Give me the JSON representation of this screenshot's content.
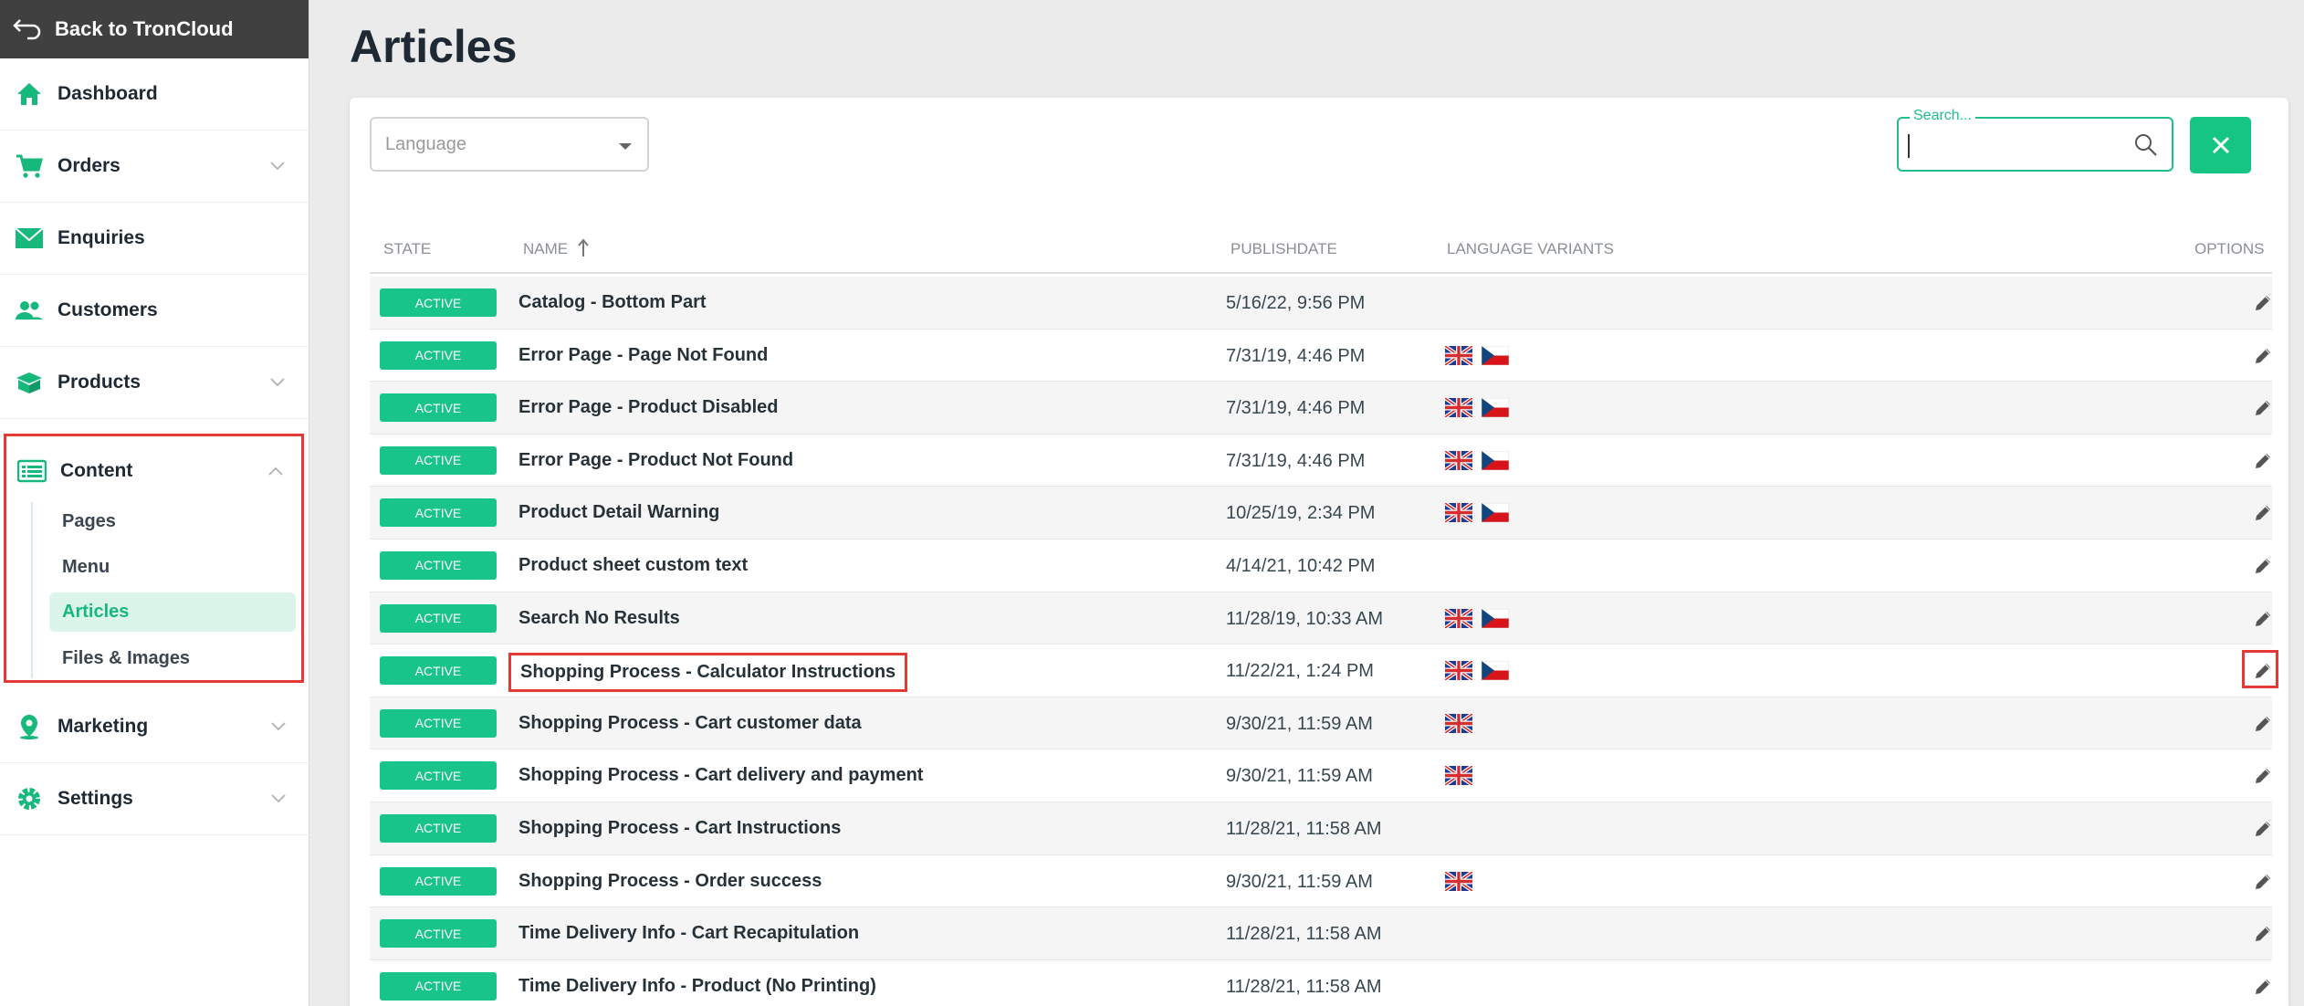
{
  "sidebar": {
    "back_label": "Back to TronCloud",
    "items": [
      {
        "label": "Dashboard",
        "icon": "home-icon"
      },
      {
        "label": "Orders",
        "icon": "cart-icon"
      },
      {
        "label": "Enquiries",
        "icon": "mail-icon"
      },
      {
        "label": "Customers",
        "icon": "people-icon"
      },
      {
        "label": "Products",
        "icon": "box-icon"
      },
      {
        "label": "Content",
        "icon": "list-icon"
      },
      {
        "label": "Marketing",
        "icon": "location-pin-icon"
      },
      {
        "label": "Settings",
        "icon": "gear-icon"
      }
    ],
    "content_sub": [
      "Pages",
      "Menu",
      "Articles",
      "Files & Images"
    ]
  },
  "page": {
    "title": "Articles",
    "language_placeholder": "Language",
    "search_label": "Search..."
  },
  "table": {
    "headers": {
      "state": "STATE",
      "name": "NAME",
      "publishdate": "PUBLISHDATE",
      "variants": "LANGUAGE VARIANTS",
      "options": "OPTIONS"
    },
    "rows": [
      {
        "state": "ACTIVE",
        "name": "Catalog - Bottom Part",
        "date": "5/16/22, 9:56 PM",
        "flags": []
      },
      {
        "state": "ACTIVE",
        "name": "Error Page - Page Not Found",
        "date": "7/31/19, 4:46 PM",
        "flags": [
          "uk",
          "cz"
        ]
      },
      {
        "state": "ACTIVE",
        "name": "Error Page - Product Disabled",
        "date": "7/31/19, 4:46 PM",
        "flags": [
          "uk",
          "cz"
        ]
      },
      {
        "state": "ACTIVE",
        "name": "Error Page - Product Not Found",
        "date": "7/31/19, 4:46 PM",
        "flags": [
          "uk",
          "cz"
        ]
      },
      {
        "state": "ACTIVE",
        "name": "Product Detail Warning",
        "date": "10/25/19, 2:34 PM",
        "flags": [
          "uk",
          "cz"
        ]
      },
      {
        "state": "ACTIVE",
        "name": "Product sheet custom text",
        "date": "4/14/21, 10:42 PM",
        "flags": []
      },
      {
        "state": "ACTIVE",
        "name": "Search No Results",
        "date": "11/28/19, 10:33 AM",
        "flags": [
          "uk",
          "cz"
        ]
      },
      {
        "state": "ACTIVE",
        "name": "Shopping Process - Calculator Instructions",
        "date": "11/22/21, 1:24 PM",
        "flags": [
          "uk",
          "cz"
        ]
      },
      {
        "state": "ACTIVE",
        "name": "Shopping Process - Cart customer data",
        "date": "9/30/21, 11:59 AM",
        "flags": [
          "uk"
        ]
      },
      {
        "state": "ACTIVE",
        "name": "Shopping Process - Cart delivery and payment",
        "date": "9/30/21, 11:59 AM",
        "flags": [
          "uk"
        ]
      },
      {
        "state": "ACTIVE",
        "name": "Shopping Process - Cart Instructions",
        "date": "11/28/21, 11:58 AM",
        "flags": []
      },
      {
        "state": "ACTIVE",
        "name": "Shopping Process - Order success",
        "date": "9/30/21, 11:59 AM",
        "flags": [
          "uk"
        ]
      },
      {
        "state": "ACTIVE",
        "name": "Time Delivery Info - Cart Recapitulation",
        "date": "11/28/21, 11:58 AM",
        "flags": []
      },
      {
        "state": "ACTIVE",
        "name": "Time Delivery Info - Product (No Printing)",
        "date": "11/28/21, 11:58 AM",
        "flags": []
      }
    ]
  },
  "colors": {
    "accent": "#14c583",
    "highlight": "#e53935",
    "sidebar_header": "#404040"
  }
}
